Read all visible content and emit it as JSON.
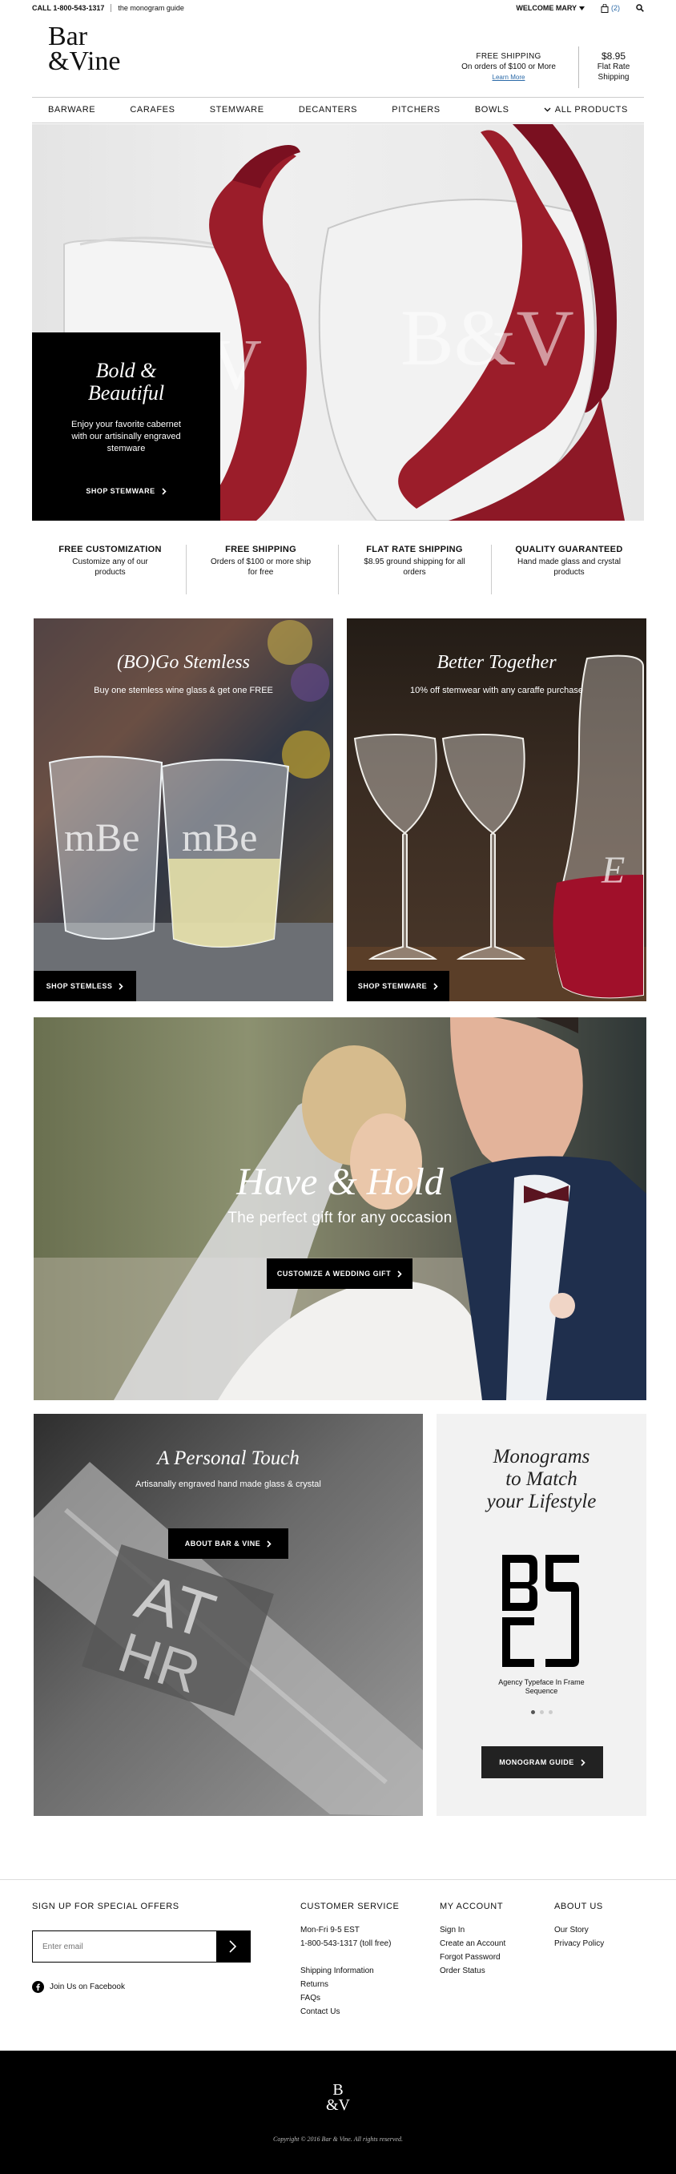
{
  "topbar": {
    "call": "CALL 1-800-543-1317",
    "guide_link": "the monogram guide",
    "welcome": "WELCOME MARY",
    "cart_count": "(2)"
  },
  "header": {
    "logo_line1": "Bar",
    "logo_line2": "&Vine",
    "free_shipping_title": "FREE SHIPPING",
    "free_shipping_sub": "On orders of $100 or More",
    "learn_more": "Learn More",
    "flat_price": "$8.95",
    "flat_line1": "Flat Rate",
    "flat_line2": "Shipping"
  },
  "nav": {
    "items": [
      "BARWARE",
      "CARAFES",
      "STEMWARE",
      "DECANTERS",
      "PITCHERS",
      "BOWLS"
    ],
    "all_products": "ALL PRODUCTS"
  },
  "hero": {
    "title_line1": "Bold &",
    "title_line2": "Beautiful",
    "body": "Enjoy your favorite cabernet with our artisinally engraved stemware",
    "button": "SHOP STEMWARE",
    "engraving_left": "V",
    "engraving_right": "B&V"
  },
  "usps": [
    {
      "title": "FREE CUSTOMIZATION",
      "text": "Customize any of our products"
    },
    {
      "title": "FREE SHIPPING",
      "text": "Orders of $100 or more ship for free"
    },
    {
      "title": "FLAT RATE SHIPPING",
      "text": "$8.95 ground shipping for all orders"
    },
    {
      "title": "QUALITY GUARANTEED",
      "text": "Hand made glass and crystal products"
    }
  ],
  "promo_left": {
    "title": "(BO)Go Stemless",
    "sub": "Buy one stemless wine glass & get one FREE",
    "button": "SHOP STEMLESS",
    "engraving": "mBe"
  },
  "promo_right": {
    "title": "Better Together",
    "sub": "10% off stemwear with any caraffe purchase",
    "button": "SHOP STEMWARE",
    "engraving": "E"
  },
  "wedding": {
    "title": "Have & Hold",
    "sub": "The perfect gift for any occasion",
    "button": "CUSTOMIZE A WEDDING GIFT"
  },
  "personal": {
    "title": "A Personal Touch",
    "sub": "Artisanally engraved hand made glass & crystal",
    "button": "ABOUT BAR & VINE",
    "engraving_top": "AT",
    "engraving_bottom": "HR"
  },
  "monogram": {
    "title_line1": "Monograms",
    "title_line2": "to Match",
    "title_line3": "your Lifestyle",
    "sample": "BSCS",
    "caption_line1": "Agency Typeface In Frame",
    "caption_line2": "Sequence",
    "button": "MONOGRAM GUIDE"
  },
  "footer": {
    "signup_title": "SIGN UP FOR SPECIAL OFFERS",
    "email_placeholder": "Enter email",
    "facebook": "Join Us on Facebook",
    "customer_service_title": "CUSTOMER SERVICE",
    "cs_items": [
      "Mon-Fri 9-5 EST",
      "1-800-543-1317 (toll free)",
      "",
      "Shipping Information",
      "Returns",
      "FAQs",
      "Contact Us"
    ],
    "account_title": "MY ACCOUNT",
    "account_items": [
      "Sign In",
      "Create an Account",
      "Forgot Password",
      "Order Status"
    ],
    "about_title": "ABOUT US",
    "about_items": [
      "Our Story",
      "Privacy Policy"
    ],
    "bottom_logo_line1": "B",
    "bottom_logo_line2": "&V",
    "copyright": "Copyright © 2016 Bar & Vine. All rights reserved."
  },
  "colors": {
    "black": "#000000",
    "wine": "#9b1d2a",
    "link_blue": "#2b6aa8",
    "panel_gray": "#f2f2f2"
  }
}
